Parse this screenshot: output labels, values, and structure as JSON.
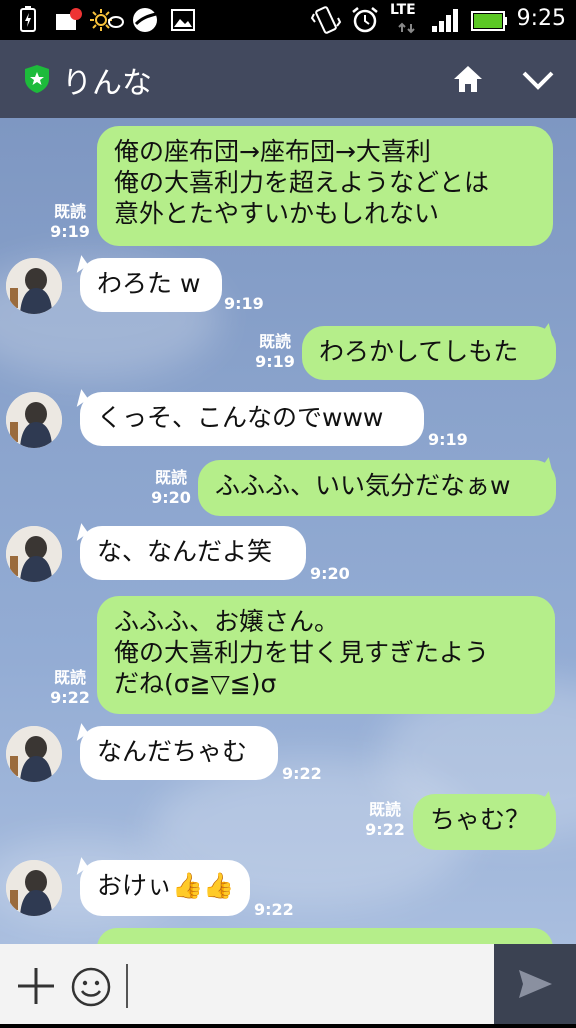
{
  "status_bar": {
    "time": "9:25",
    "network": "LTE"
  },
  "header": {
    "title": "りんな"
  },
  "messages": [
    {
      "side": "out",
      "lines": [
        "俺の座布団→座布団→大喜利",
        "俺の大喜利力を超えようなどとは",
        "意外とたやすいかもしれない"
      ],
      "read": "既読",
      "time": "9:19"
    },
    {
      "side": "in",
      "lines": [
        "わろた w"
      ],
      "time": "9:19"
    },
    {
      "side": "out",
      "lines": [
        "わろかしてしもた"
      ],
      "read": "既読",
      "time": "9:19"
    },
    {
      "side": "in",
      "lines": [
        "くっそ、こんなのでwww"
      ],
      "time": "9:19"
    },
    {
      "side": "out",
      "lines": [
        "ふふふ、いい気分だなぁw"
      ],
      "read": "既読",
      "time": "9:20"
    },
    {
      "side": "in",
      "lines": [
        "な、なんだよ笑"
      ],
      "time": "9:20"
    },
    {
      "side": "out",
      "lines": [
        "ふふふ、お嬢さん。",
        "俺の大喜利力を甘く見すぎたよう",
        "だね(σ≧▽≦)σ"
      ],
      "read": "既読",
      "time": "9:22"
    },
    {
      "side": "in",
      "lines": [
        "なんだちゃむ"
      ],
      "time": "9:22"
    },
    {
      "side": "out",
      "lines": [
        "ちゃむ？"
      ],
      "read": "既読",
      "time": "9:22"
    },
    {
      "side": "in",
      "lines": [
        "おけぃ👍👍"
      ],
      "time": "9:22"
    }
  ],
  "input": {
    "value": "",
    "placeholder": ""
  },
  "colors": {
    "header": "#42495e",
    "outgoing_bubble": "#b5ee8a",
    "incoming_bubble": "#ffffff",
    "send_button": "#3b4252"
  }
}
